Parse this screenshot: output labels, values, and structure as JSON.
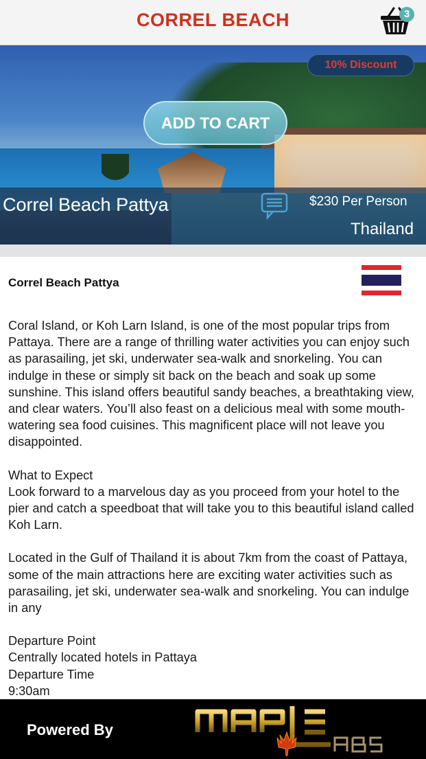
{
  "header": {
    "title": "CORREL BEACH",
    "cart_count": "3",
    "cart_icon": "shopping-basket-icon"
  },
  "hero": {
    "discount_label": "10% Discount",
    "add_to_cart_label": "ADD TO CART",
    "tour_name": "Correl  Beach Pattya",
    "comment_icon": "comment-icon",
    "price_label": "$230 Per  Person",
    "country": "Thailand"
  },
  "content": {
    "title": "Correl Beach Pattya",
    "flag_icon": "thailand-flag-icon",
    "paragraphs": [
      "Coral Island, or Koh Larn Island, is one of the most popular trips from Pattaya. There are a range of thrilling water activities you can enjoy such as parasailing, jet ski, underwater sea-walk and snorkeling. You can indulge in these or simply sit back on the beach and soak up some sunshine. This island offers beautiful sandy beaches, a breathtaking view, and clear waters. You’ll also feast on a delicious meal with some mouth-watering sea food cuisines. This magnificent place will not leave you disappointed.",
      "What to Expect\nLook forward to a marvelous day as you proceed from your hotel to the pier and catch a speedboat that will take you to this beautiful island called Koh Larn.",
      "Located in the Gulf of Thailand it is about 7km from the coast of Pattaya, some of the main attractions here are exciting water activities such as parasailing, jet ski, underwater sea-walk and snorkeling. You can indulge in any",
      "Departure Point\nCentrally located hotels in Pattaya\nDeparture Time\n9:30am"
    ]
  },
  "footer": {
    "powered_by_label": "Powered By",
    "logo_text": "MAPLE LABS"
  },
  "colors": {
    "title_red": "#d0301c",
    "discount_text": "#e43a2a",
    "footer_bg": "#000000",
    "logo_gold": "#c9a227"
  }
}
